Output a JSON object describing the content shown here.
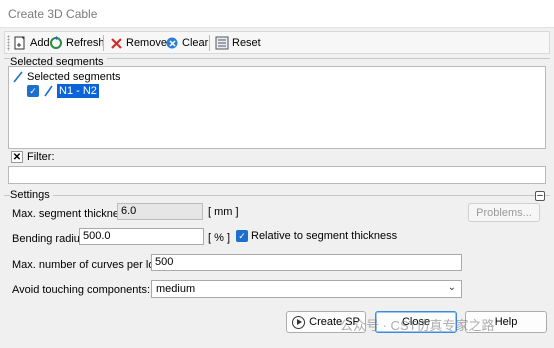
{
  "window": {
    "title": "Create 3D Cable"
  },
  "toolbar": {
    "add_label": "Add",
    "refresh_label": "Refresh",
    "remove_label": "Remove",
    "clear_label": "Clear",
    "reset_label": "Reset",
    "icons": [
      "add-icon",
      "refresh-icon",
      "remove-icon",
      "clear-icon",
      "reset-icon"
    ]
  },
  "selected_segments": {
    "group_label": "Selected segments",
    "root_label": "Selected segments",
    "items": [
      {
        "label": "N1 - N2",
        "checked": true,
        "selected": true
      }
    ]
  },
  "filter": {
    "label": "Filter:",
    "value": ""
  },
  "settings": {
    "group_label": "Settings",
    "max_segment_thickness": {
      "label": "Max. segment thickness:",
      "value": "6.0",
      "unit": "[ mm ]"
    },
    "problems_button": "Problems...",
    "bending_radius": {
      "label": "Bending radius:",
      "value": "500.0",
      "unit": "[ % ]"
    },
    "relative_checkbox": {
      "label": "Relative to segment thickness",
      "checked": true
    },
    "max_curves": {
      "label": "Max. number of curves per loft:",
      "value": "500"
    },
    "avoid_touching": {
      "label": "Avoid touching components:",
      "value": "medium"
    }
  },
  "buttons": {
    "create": "Create SP",
    "close": "Close",
    "help": "Help"
  },
  "watermark": {
    "text": "公众号 · CST仿真专家之路"
  },
  "colors": {
    "accent": "#1d6fce",
    "selection": "#0a64d8",
    "remove_red": "#d22c2c"
  }
}
